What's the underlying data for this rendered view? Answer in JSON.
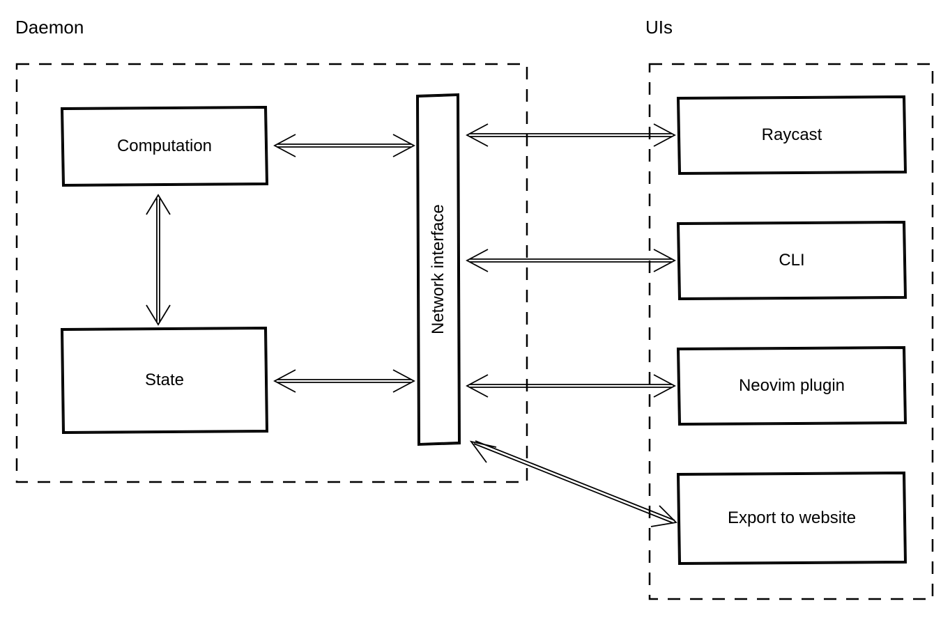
{
  "groups": {
    "daemon": {
      "title": "Daemon"
    },
    "uis": {
      "title": "UIs"
    }
  },
  "boxes": {
    "computation": {
      "label": "Computation"
    },
    "state": {
      "label": "State"
    },
    "network_interface": {
      "label": "Network interface"
    },
    "raycast": {
      "label": "Raycast"
    },
    "cli": {
      "label": "CLI"
    },
    "neovim_plugin": {
      "label": "Neovim plugin"
    },
    "export_to_website": {
      "label": "Export to website"
    }
  },
  "diagram_structure": {
    "description": "Architecture diagram with Daemon and UIs groups connected via Network interface",
    "daemon_group_contains": [
      "computation",
      "state",
      "network_interface"
    ],
    "uis_group_contains": [
      "raycast",
      "cli",
      "neovim_plugin",
      "export_to_website"
    ],
    "connections": [
      {
        "from": "computation",
        "to": "state",
        "type": "bidirectional"
      },
      {
        "from": "computation",
        "to": "network_interface",
        "type": "bidirectional"
      },
      {
        "from": "state",
        "to": "network_interface",
        "type": "bidirectional"
      },
      {
        "from": "network_interface",
        "to": "raycast",
        "type": "bidirectional"
      },
      {
        "from": "network_interface",
        "to": "cli",
        "type": "bidirectional"
      },
      {
        "from": "network_interface",
        "to": "neovim_plugin",
        "type": "bidirectional"
      },
      {
        "from": "network_interface",
        "to": "export_to_website",
        "type": "bidirectional"
      }
    ]
  }
}
